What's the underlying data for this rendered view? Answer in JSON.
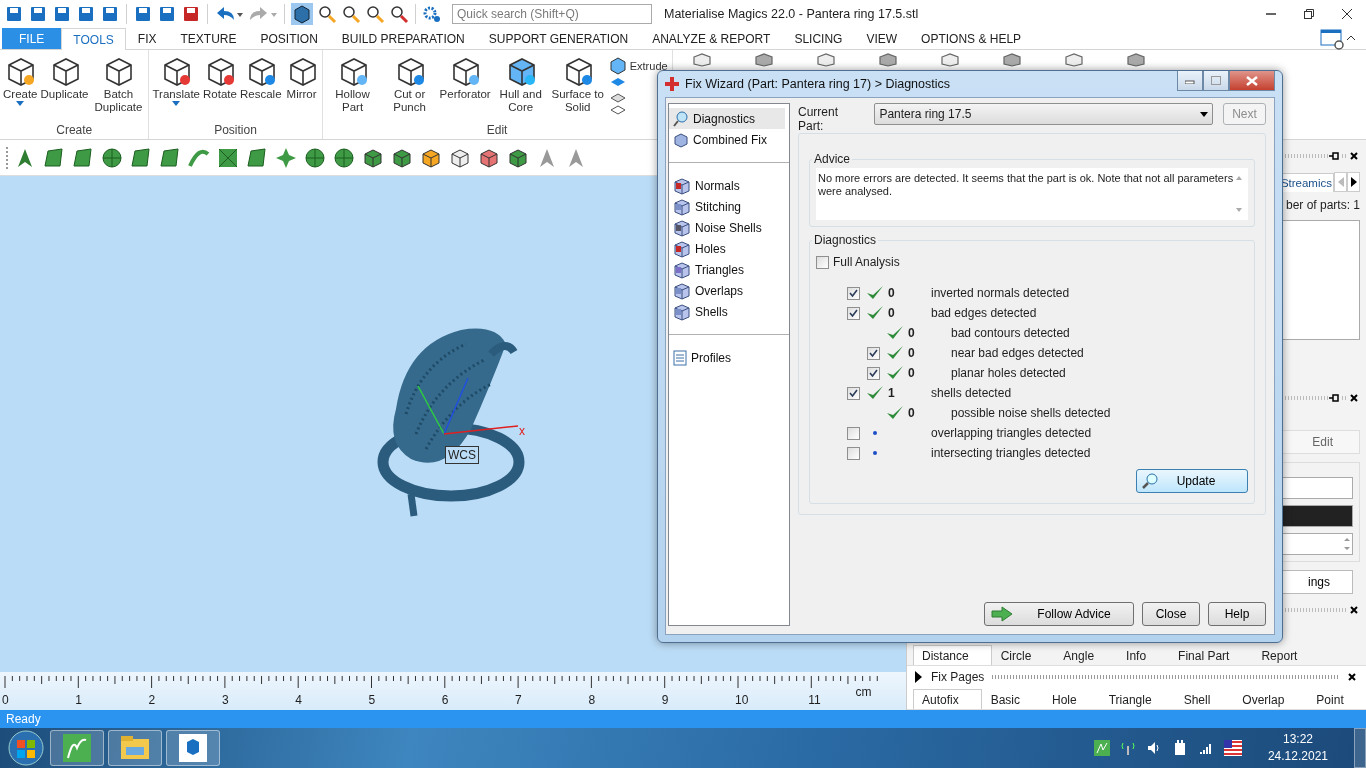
{
  "app": {
    "title": "Materialise Magics 22.0 - Pantera ring 17.5.stl",
    "search": {
      "placeholder": "Quick search (Shift+Q)"
    }
  },
  "menu_tabs": [
    {
      "label": "FILE",
      "kind": "file",
      "selected": false
    },
    {
      "label": "TOOLS",
      "kind": "tab",
      "selected": true
    },
    {
      "label": "FIX",
      "kind": "tab",
      "selected": false
    },
    {
      "label": "TEXTURE",
      "kind": "tab",
      "selected": false
    },
    {
      "label": "POSITION",
      "kind": "tab",
      "selected": false
    },
    {
      "label": "BUILD PREPARATION",
      "kind": "tab",
      "selected": false
    },
    {
      "label": "SUPPORT GENERATION",
      "kind": "tab",
      "selected": false
    },
    {
      "label": "ANALYZE & REPORT",
      "kind": "tab",
      "selected": false
    },
    {
      "label": "SLICING",
      "kind": "tab",
      "selected": false
    },
    {
      "label": "VIEW",
      "kind": "tab",
      "selected": false
    },
    {
      "label": "OPTIONS & HELP",
      "kind": "tab",
      "selected": false
    }
  ],
  "ribbon": {
    "groups": [
      {
        "title": "Create",
        "tools": [
          {
            "label": "Create",
            "dropdown": true
          },
          {
            "label": "Duplicate",
            "dropdown": false
          },
          {
            "label": "Batch Duplicate",
            "dropdown": false
          }
        ]
      },
      {
        "title": "Position",
        "tools": [
          {
            "label": "Translate",
            "dropdown": true
          },
          {
            "label": "Rotate",
            "dropdown": false
          },
          {
            "label": "Rescale",
            "dropdown": false
          },
          {
            "label": "Mirror",
            "dropdown": false
          }
        ]
      },
      {
        "title": "Edit",
        "tools": [
          {
            "label": "Hollow Part",
            "dropdown": false
          },
          {
            "label": "Cut or Punch",
            "dropdown": false
          },
          {
            "label": "Perforator",
            "dropdown": false
          },
          {
            "label": "Hull and Core",
            "dropdown": false
          },
          {
            "label": "Surface to Solid",
            "dropdown": false
          }
        ],
        "extra": "Extrude"
      }
    ]
  },
  "viewport": {
    "axis_label": "x",
    "wcs_label": "WCS"
  },
  "ruler": {
    "labels": [
      "0",
      "1",
      "2",
      "3",
      "4",
      "5",
      "6",
      "7",
      "8",
      "9",
      "10",
      "11"
    ],
    "unit": "cm"
  },
  "right_panel": {
    "tab": "Streamics",
    "parts_count": "ber of parts: 1",
    "edit_button": "Edit",
    "settings_button": "ings",
    "measure_tabs": [
      {
        "label": "Distance",
        "selected": true
      },
      {
        "label": "Circle",
        "selected": false
      },
      {
        "label": "Angle",
        "selected": false
      },
      {
        "label": "Info",
        "selected": false
      },
      {
        "label": "Final Part",
        "selected": false
      },
      {
        "label": "Report",
        "selected": false
      }
    ],
    "fix_pages": {
      "title": "Fix Pages",
      "tabs": [
        {
          "label": "Autofix",
          "selected": true
        },
        {
          "label": "Basic",
          "selected": false
        },
        {
          "label": "Hole",
          "selected": false
        },
        {
          "label": "Triangle",
          "selected": false
        },
        {
          "label": "Shell",
          "selected": false
        },
        {
          "label": "Overlap",
          "selected": false
        },
        {
          "label": "Point",
          "selected": false
        }
      ]
    }
  },
  "dialog": {
    "title": "Fix Wizard (Part: Pantera ring 17) > Diagnostics",
    "nav": [
      {
        "items": [
          {
            "label": "Diagnostics",
            "selected": true
          },
          {
            "label": "Combined Fix",
            "selected": false
          }
        ]
      },
      {
        "items": [
          {
            "label": "Normals",
            "selected": false
          },
          {
            "label": "Stitching",
            "selected": false
          },
          {
            "label": "Noise Shells",
            "selected": false
          },
          {
            "label": "Holes",
            "selected": false
          },
          {
            "label": "Triangles",
            "selected": false
          },
          {
            "label": "Overlaps",
            "selected": false
          },
          {
            "label": "Shells",
            "selected": false
          }
        ]
      },
      {
        "items": [
          {
            "label": "Profiles",
            "selected": false
          }
        ]
      }
    ],
    "current_part_label": "Current Part:",
    "current_part": "Pantera ring 17.5",
    "next_button": {
      "label": "Next",
      "disabled": true
    },
    "advice": {
      "title": "Advice",
      "text": "No more errors are detected. It seems that the part is ok. Note that not all parameters were analysed."
    },
    "diagnostics": {
      "title": "Diagnostics",
      "full_analysis": {
        "label": "Full Analysis",
        "checked": false
      },
      "checks": [
        {
          "kind": "checkbox",
          "checked": true,
          "passed": true,
          "count": "0",
          "label": "inverted normals detected"
        },
        {
          "kind": "checkbox",
          "checked": true,
          "passed": true,
          "count": "0",
          "label": "bad edges detected",
          "children": [
            {
              "kind": "plain",
              "passed": true,
              "count": "0",
              "label": "bad contours detected"
            },
            {
              "kind": "checkbox",
              "checked": true,
              "passed": true,
              "count": "0",
              "label": "near bad edges detected"
            },
            {
              "kind": "checkbox",
              "checked": true,
              "passed": true,
              "count": "0",
              "label": "planar holes detected"
            }
          ]
        },
        {
          "kind": "checkbox",
          "checked": true,
          "passed": true,
          "count": "1",
          "label": "shells detected",
          "children": [
            {
              "kind": "plain",
              "passed": true,
              "count": "0",
              "label": "possible noise shells detected"
            }
          ]
        },
        {
          "kind": "checkbox",
          "checked": false,
          "passed": false,
          "label": "overlapping triangles detected"
        },
        {
          "kind": "checkbox",
          "checked": false,
          "passed": false,
          "label": "intersecting triangles detected"
        }
      ],
      "update_button": "Update"
    },
    "buttons": [
      "Follow Advice",
      "Close",
      "Help"
    ]
  },
  "status_bar": {
    "text": "Ready"
  },
  "taskbar": {
    "time": "13:22",
    "date": "24.12.2021"
  }
}
